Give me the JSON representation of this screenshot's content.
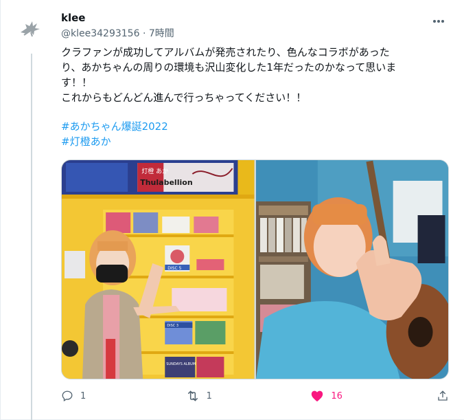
{
  "tweet": {
    "display_name": "klee",
    "handle": "@klee34293156",
    "separator": "·",
    "time": "7時間",
    "text_lines": [
      "クラファンが成功してアルバムが発売されたり、色んなコラボがあった",
      "り、あかちゃんの周りの環境も沢山変化した1年だったのかなって思いま",
      "す！！",
      "これからもどんどん進んで行っちゃってください！！"
    ],
    "hashtags": [
      "#あかちゃん爆誕2022",
      "#灯橙あか"
    ]
  },
  "media": {
    "photos": [
      {
        "scene": "woman-at-cd-shop-display"
      },
      {
        "scene": "woman-with-guitar-thumbs-up"
      }
    ],
    "signboard_text": "灯橙 あか",
    "signboard_sub": "Thulabellion",
    "disc_label": "DISC 5",
    "disc_label2": "DISC 3",
    "album_sign": "SUNDAYS ALBUM"
  },
  "actions": {
    "reply_count": "1",
    "retweet_count": "1",
    "like_count": "16"
  },
  "colors": {
    "accent": "#1d9bf0",
    "like": "#f91880",
    "muted": "#536471"
  },
  "icons": [
    "bird-logo-icon",
    "more-icon",
    "reply-icon",
    "retweet-icon",
    "heart-icon",
    "share-icon"
  ]
}
